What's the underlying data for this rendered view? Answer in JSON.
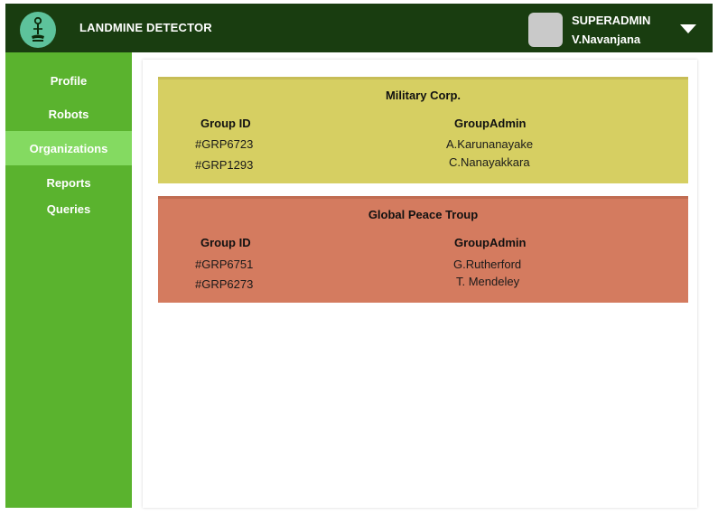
{
  "header": {
    "app_title": "LANDMINE DETECTOR",
    "user_role": "SUPERADMIN",
    "user_name": "V.Navanjana",
    "logo_icon": "landmine-detector-logo",
    "dropdown_icon": "caret-down-icon"
  },
  "sidebar": {
    "items": [
      {
        "label": "Profile"
      },
      {
        "label": "Robots"
      },
      {
        "label": "Organizations",
        "active": true
      },
      {
        "label": "Reports"
      },
      {
        "label": "Queries"
      }
    ]
  },
  "organizations": [
    {
      "name": "Military Corp.",
      "color": "#d6cf62",
      "col_group_id": "Group ID",
      "col_group_admin": "GroupAdmin",
      "rows": [
        {
          "group_id": "#GRP6723",
          "admin": "A.Karunanayake"
        },
        {
          "group_id": "#GRP1293",
          "admin": "C.Nanayakkara"
        }
      ]
    },
    {
      "name": "Global Peace Troup",
      "color": "#d47b5f",
      "col_group_id": "Group ID",
      "col_group_admin": "GroupAdmin",
      "rows": [
        {
          "group_id": "#GRP6751",
          "admin": "G.Rutherford"
        },
        {
          "group_id": "#GRP6273",
          "admin": "T. Mendeley"
        }
      ]
    }
  ],
  "colors": {
    "header_bg": "#193d10",
    "sidebar_bg": "#5ab32e",
    "sidebar_active": "#84da61"
  }
}
